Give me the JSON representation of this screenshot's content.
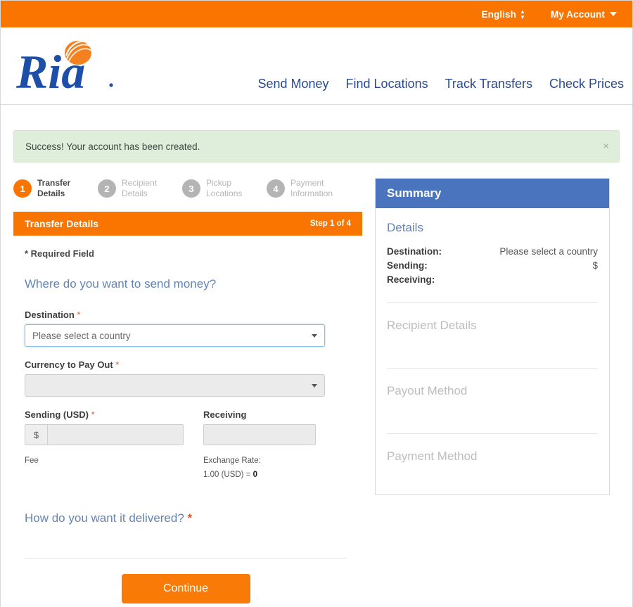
{
  "topbar": {
    "language": "English",
    "language_icon": "up-down-arrows-icon",
    "account": "My Account",
    "account_icon": "chevron-down-icon"
  },
  "brand": {
    "logo_text": "Ria",
    "logo_icon": "ria-globe-icon",
    "logo_blue": "#1d4fa8",
    "logo_orange": "#f4801f"
  },
  "nav": {
    "items": [
      {
        "label": "Send Money"
      },
      {
        "label": "Find Locations"
      },
      {
        "label": "Track Transfers"
      },
      {
        "label": "Check Prices"
      }
    ]
  },
  "banner": {
    "message": "Success! Your account has been created.",
    "close_label": "×",
    "background": "#dfeeda"
  },
  "steps": [
    {
      "number": "1",
      "line1": "Transfer",
      "line2": "Details",
      "active": true
    },
    {
      "number": "2",
      "line1": "Recipient",
      "line2": "Details",
      "active": false
    },
    {
      "number": "3",
      "line1": "Pickup",
      "line2": "Locations",
      "active": false
    },
    {
      "number": "4",
      "line1": "Payment",
      "line2": "Information",
      "active": false
    }
  ],
  "panel": {
    "title": "Transfer Details",
    "step_text": "Step 1 of 4",
    "accent": "#fa7500"
  },
  "form": {
    "required_note": "* Required Field",
    "required_star": "*",
    "question": "Where do you want to send money?",
    "destination": {
      "label": "Destination",
      "star": "*",
      "value": "Please select a country",
      "arrow_icon": "chevron-down-icon"
    },
    "currency": {
      "label": "Currency to Pay Out",
      "star": "*",
      "value": "",
      "arrow_icon": "chevron-down-icon"
    },
    "sending": {
      "label": "Sending (USD)",
      "star": "*",
      "prefix": "$",
      "value": "",
      "placeholder": ""
    },
    "receiving": {
      "label": "Receiving",
      "value": "",
      "placeholder": ""
    },
    "fee_label": "Fee",
    "exchange_rate_label": "Exchange Rate:",
    "exchange_rate_value_prefix": "1.00 (USD) = ",
    "exchange_rate_value": "0",
    "delivery_question": "How do you want it delivered?",
    "delivery_star": "*",
    "continue_label": "Continue"
  },
  "summary": {
    "header": "Summary",
    "header_color": "#4b74be",
    "details_title": "Details",
    "rows": [
      {
        "key": "Destination:",
        "value": "Please select a country"
      },
      {
        "key": "Sending:",
        "value": "$"
      },
      {
        "key": "Receiving:",
        "value": ""
      }
    ],
    "recipient_details_title": "Recipient Details",
    "payout_method_title": "Payout Method",
    "payment_method_title": "Payment Method"
  }
}
